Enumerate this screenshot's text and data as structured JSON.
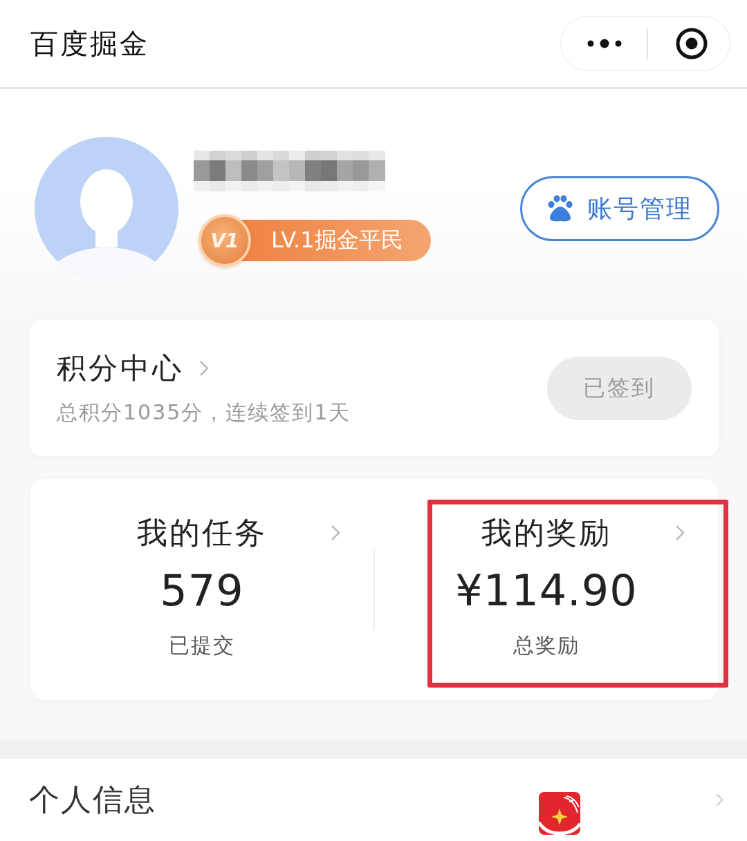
{
  "window": {
    "title": "百度掘金"
  },
  "profile": {
    "level_badge": {
      "medal": "V1",
      "label": "LV.1掘金平民"
    },
    "account_button": {
      "label": "账号管理"
    }
  },
  "points_card": {
    "title": "积分中心",
    "summary": "总积分1035分，连续签到1天",
    "checkin_button": {
      "label": "已签到",
      "disabled": true
    }
  },
  "stats": [
    {
      "title": "我的任务",
      "value": "579",
      "caption": "已提交",
      "highlighted": false
    },
    {
      "title": "我的奖励",
      "value": "¥114.90",
      "caption": "总奖励",
      "highlighted": true
    }
  ],
  "menu": [
    {
      "label": "个人信息"
    }
  ]
}
